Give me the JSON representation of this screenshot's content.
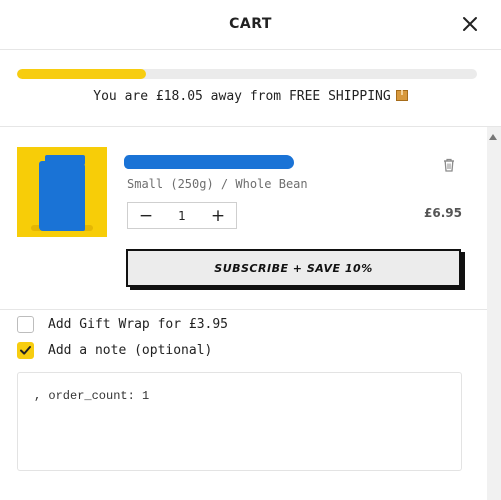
{
  "header": {
    "title": "CART",
    "close_icon": "close-icon"
  },
  "shipping": {
    "progress_percent": 28,
    "message": "You are £18.05 away from FREE SHIPPING",
    "icon": "package-icon",
    "accent_color": "#f7cd10"
  },
  "cart": {
    "items": [
      {
        "variant": "Small (250g) / Whole Bean",
        "quantity": "1",
        "decrement_label": "−",
        "increment_label": "+",
        "price": "£6.95",
        "subscribe_label": "SUBSCRIBE + SAVE 10%"
      }
    ]
  },
  "options": {
    "gift_wrap_label": "Add Gift Wrap for £3.95",
    "gift_wrap_checked": false,
    "note_label": "Add a note (optional)",
    "note_checked": true,
    "note_value": ", order_count: 1"
  }
}
